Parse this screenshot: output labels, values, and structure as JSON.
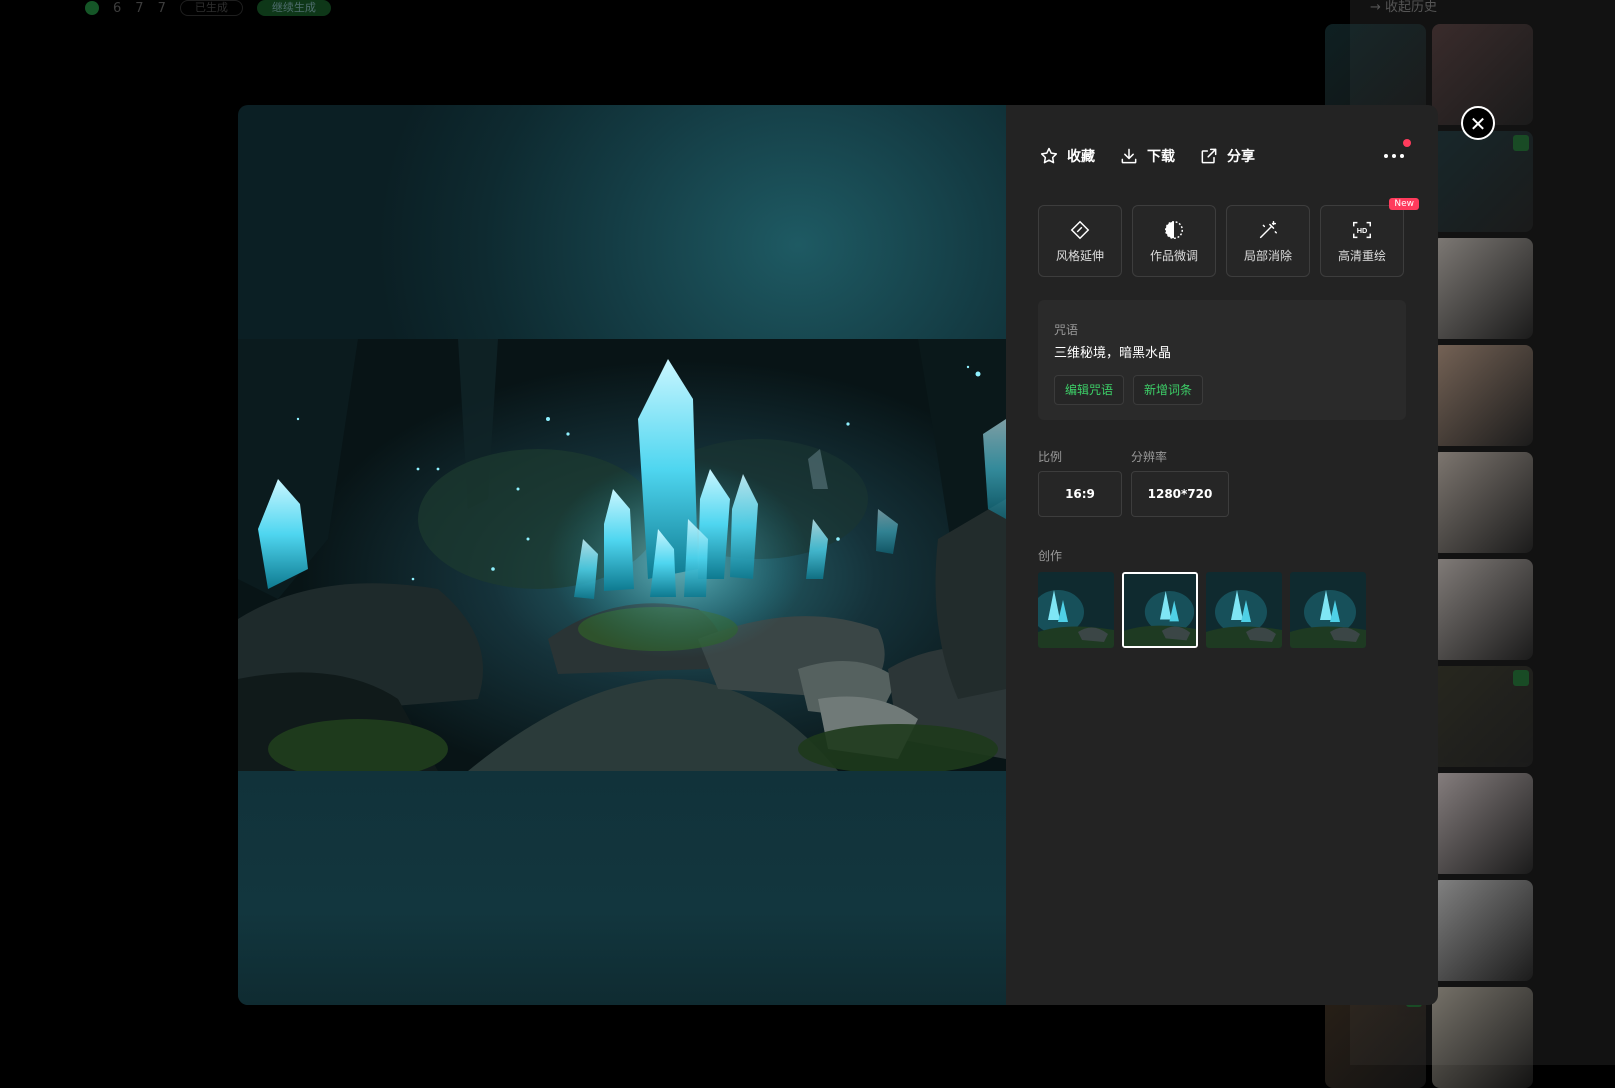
{
  "background_page": {
    "topbar_numbers": [
      "6",
      "7",
      "7"
    ],
    "topbar_pills": [
      "已生成",
      "继续生成"
    ],
    "sidebar_header": "→ 收起历史"
  },
  "actions": {
    "favorite": "收藏",
    "download": "下载",
    "share": "分享"
  },
  "tools": [
    {
      "label": "风格延伸",
      "icon": "style-extend-icon"
    },
    {
      "label": "作品微调",
      "icon": "fine-tune-icon"
    },
    {
      "label": "局部消除",
      "icon": "magic-erase-icon"
    },
    {
      "label": "高清重绘",
      "icon": "hd-icon",
      "badge": "New"
    }
  ],
  "prompt": {
    "caption": "咒语",
    "text": "三维秘境，暗黑水晶",
    "edit_label": "编辑咒语",
    "add_label": "新增词条"
  },
  "meta": {
    "ratio_caption": "比例",
    "ratio_value": "16:9",
    "resolution_caption": "分辨率",
    "resolution_value": "1280*720"
  },
  "creations": {
    "caption": "创作",
    "selected_index": 1,
    "count": 4
  },
  "colors": {
    "accent_green": "#3dd068",
    "badge_red": "#ff3b5c",
    "panel_bg": "#232323"
  }
}
